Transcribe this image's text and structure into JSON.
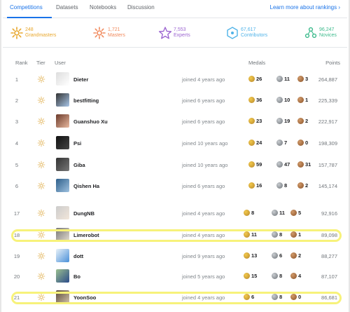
{
  "tabs": [
    {
      "label": "Competitions",
      "active": true
    },
    {
      "label": "Datasets",
      "active": false
    },
    {
      "label": "Notebooks",
      "active": false
    },
    {
      "label": "Discussion",
      "active": false
    }
  ],
  "learn_more": "Learn more about rankings ›",
  "tiers": [
    {
      "count": "248",
      "label": "Grandmasters",
      "color": "#e8a72c",
      "icon": "grandmaster-icon"
    },
    {
      "count": "1,721",
      "label": "Masters",
      "color": "#f18a5d",
      "icon": "master-icon"
    },
    {
      "count": "7,553",
      "label": "Experts",
      "color": "#9c66d1",
      "icon": "expert-icon"
    },
    {
      "count": "67,617",
      "label": "Contributors",
      "color": "#4fb3e8",
      "icon": "contributor-icon"
    },
    {
      "count": "96,247",
      "label": "Novices",
      "color": "#3cba8c",
      "icon": "novice-icon"
    }
  ],
  "table_header": {
    "rank": "Rank",
    "tier": "Tier",
    "user": "User",
    "medals": "Medals",
    "points": "Points"
  },
  "rows": [
    {
      "rank": "1",
      "name": "Dieter",
      "joined": "joined 4 years ago",
      "gold": "26",
      "silver": "11",
      "bronze": "3",
      "points": "264,887"
    },
    {
      "rank": "2",
      "name": "bestfitting",
      "joined": "joined 6 years ago",
      "gold": "36",
      "silver": "10",
      "bronze": "1",
      "points": "225,339"
    },
    {
      "rank": "3",
      "name": "Guanshuo Xu",
      "joined": "joined 6 years ago",
      "gold": "23",
      "silver": "19",
      "bronze": "2",
      "points": "222,917"
    },
    {
      "rank": "4",
      "name": "Psi",
      "joined": "joined 10 years ago",
      "gold": "24",
      "silver": "7",
      "bronze": "0",
      "points": "198,309"
    },
    {
      "rank": "5",
      "name": "Giba",
      "joined": "joined 10 years ago",
      "gold": "59",
      "silver": "47",
      "bronze": "31",
      "points": "157,787"
    },
    {
      "rank": "6",
      "name": "Qishen Ha",
      "joined": "joined 6 years ago",
      "gold": "16",
      "silver": "8",
      "bronze": "2",
      "points": "145,174"
    },
    {
      "rank": "17",
      "name": "DungNB",
      "joined": "joined 4 years ago",
      "gold": "8",
      "silver": "11",
      "bronze": "5",
      "points": "92,916"
    },
    {
      "rank": "18",
      "name": "Limerobot",
      "joined": "joined 4 years ago",
      "gold": "11",
      "silver": "8",
      "bronze": "1",
      "points": "89,098"
    },
    {
      "rank": "19",
      "name": "dott",
      "joined": "joined 9 years ago",
      "gold": "13",
      "silver": "6",
      "bronze": "2",
      "points": "88,277"
    },
    {
      "rank": "20",
      "name": "Bo",
      "joined": "joined 5 years ago",
      "gold": "15",
      "silver": "8",
      "bronze": "4",
      "points": "87,107"
    },
    {
      "rank": "21",
      "name": "YoonSoo",
      "joined": "joined 4 years ago",
      "gold": "6",
      "silver": "8",
      "bronze": "0",
      "points": "86,681"
    }
  ],
  "colors": {
    "accent": "#1a73e8",
    "highlight": "#f7f27a"
  }
}
